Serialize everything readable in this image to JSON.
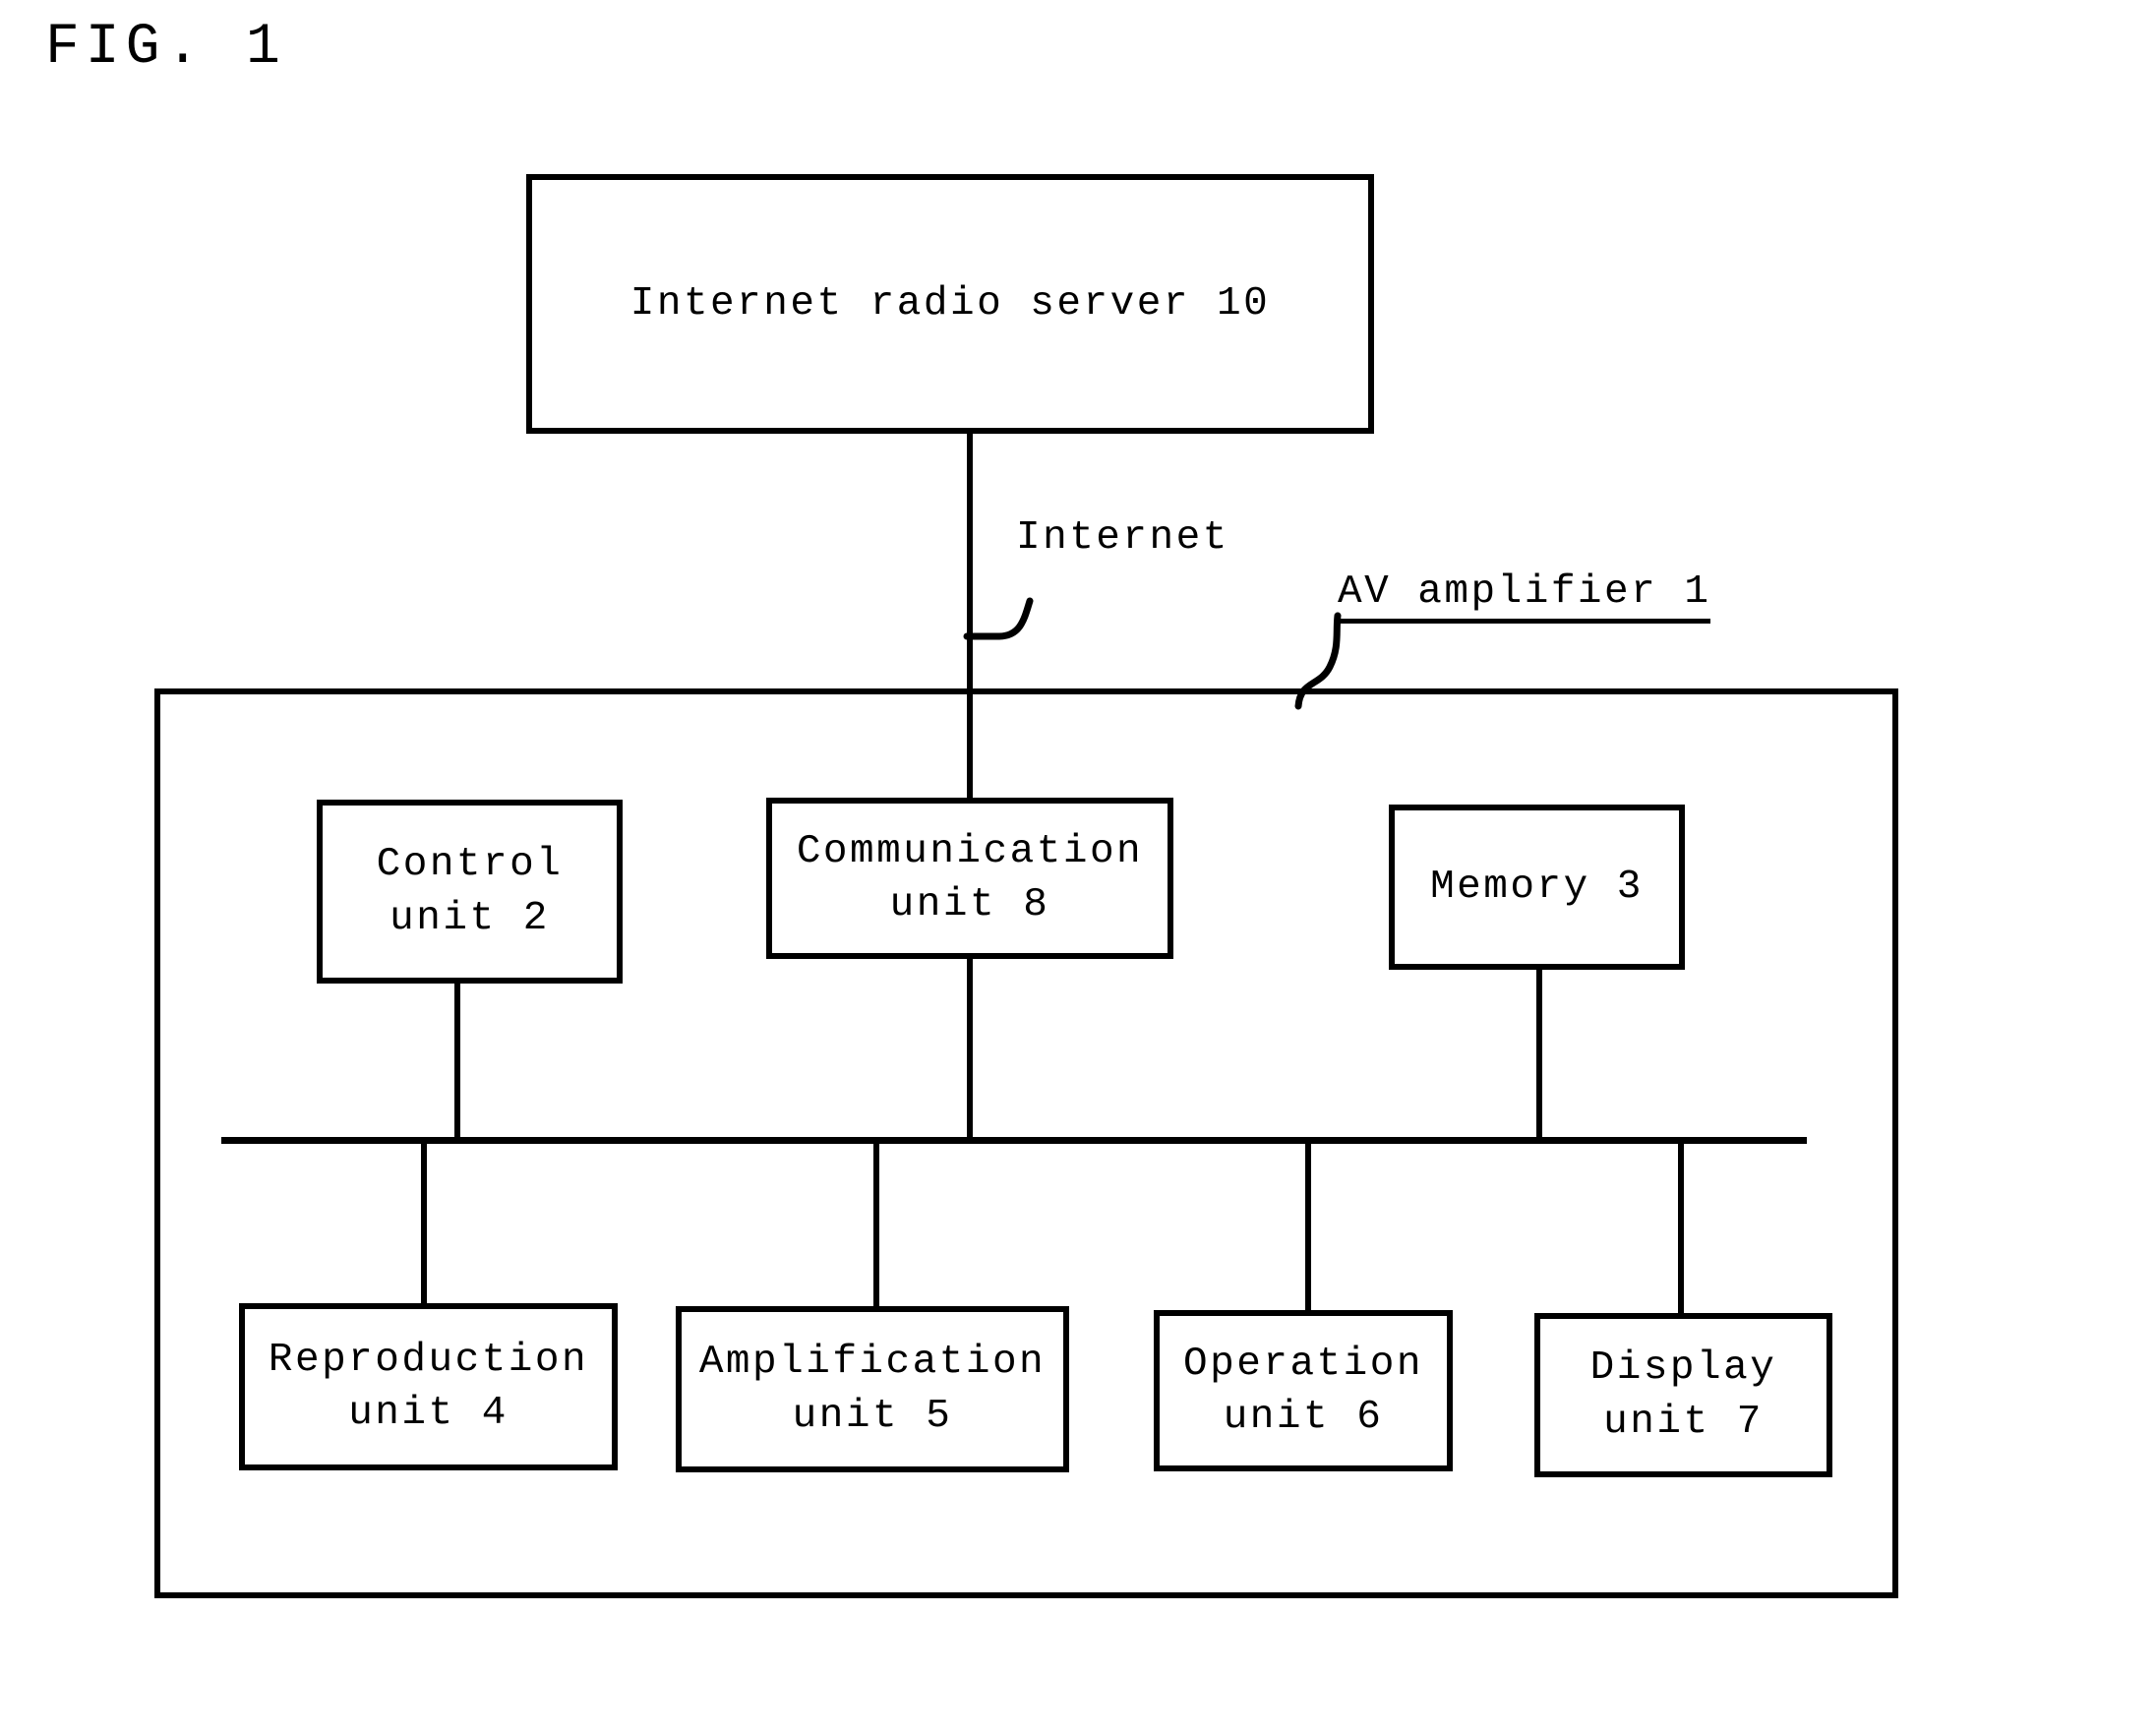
{
  "figure": {
    "title": "FIG. 1",
    "type": "patent-block-diagram"
  },
  "server": {
    "label": "Internet radio server 10"
  },
  "network": {
    "link_label": "Internet"
  },
  "enclosure": {
    "label": "AV amplifier 1"
  },
  "upper_blocks": [
    {
      "name": "control-unit",
      "label": "Control\nunit 2"
    },
    {
      "name": "communication-unit",
      "label": "Communication\nunit 8"
    },
    {
      "name": "memory",
      "label": "Memory 3"
    }
  ],
  "lower_blocks": [
    {
      "name": "reproduction-unit",
      "label": "Reproduction\nunit 4"
    },
    {
      "name": "amplification-unit",
      "label": "Amplification\nunit 5"
    },
    {
      "name": "operation-unit",
      "label": "Operation\nunit 6"
    },
    {
      "name": "display-unit",
      "label": "Display\nunit 7"
    }
  ],
  "colors": {
    "stroke": "#000000",
    "background": "#ffffff"
  }
}
